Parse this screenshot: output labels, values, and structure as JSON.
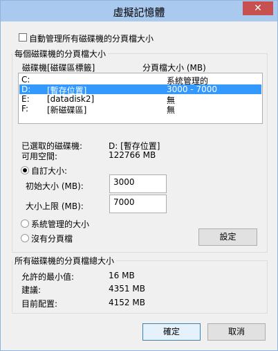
{
  "window": {
    "title": "虛擬記憶體",
    "close_glyph": "✕"
  },
  "auto_manage": {
    "label": "自動管理所有磁碟機的分頁檔大小",
    "checked": false
  },
  "per_drive": {
    "group_title": "每個磁碟機的分頁檔大小",
    "columns": [
      "磁碟機[磁碟區標籤]",
      "分頁檔大小 (MB)"
    ],
    "rows": [
      {
        "drive": "C:",
        "label": "",
        "size": "系統管理的",
        "selected": false
      },
      {
        "drive": "D:",
        "label": "[暫存位置]",
        "size": "3000 - 7000",
        "selected": true
      },
      {
        "drive": "E:",
        "label": "[datadisk2]",
        "size": "無",
        "selected": false
      },
      {
        "drive": "F:",
        "label": "[新磁碟區]",
        "size": "無",
        "selected": false
      }
    ],
    "selected_drive_label": "已選取的磁碟機:",
    "selected_drive_value": "D:  [暫存位置]",
    "free_space_label": "可用空間:",
    "free_space_value": "122766 MB",
    "custom_size_label": "自訂大小:",
    "initial_size_label": "初始大小 (MB):",
    "initial_size_value": "3000",
    "max_size_label": "大小上限 (MB):",
    "max_size_value": "7000",
    "system_managed_label": "系統管理的大小",
    "no_paging_label": "沒有分頁檔",
    "set_button": "設定",
    "selected_option": "custom"
  },
  "totals": {
    "group_title": "所有磁碟機的分頁檔總大小",
    "min_label": "允許的最小值:",
    "min_value": "16 MB",
    "recommended_label": "建議:",
    "recommended_value": "4351 MB",
    "current_label": "目前配置:",
    "current_value": "4152 MB"
  },
  "footer": {
    "ok": "確定",
    "cancel": "取消"
  }
}
